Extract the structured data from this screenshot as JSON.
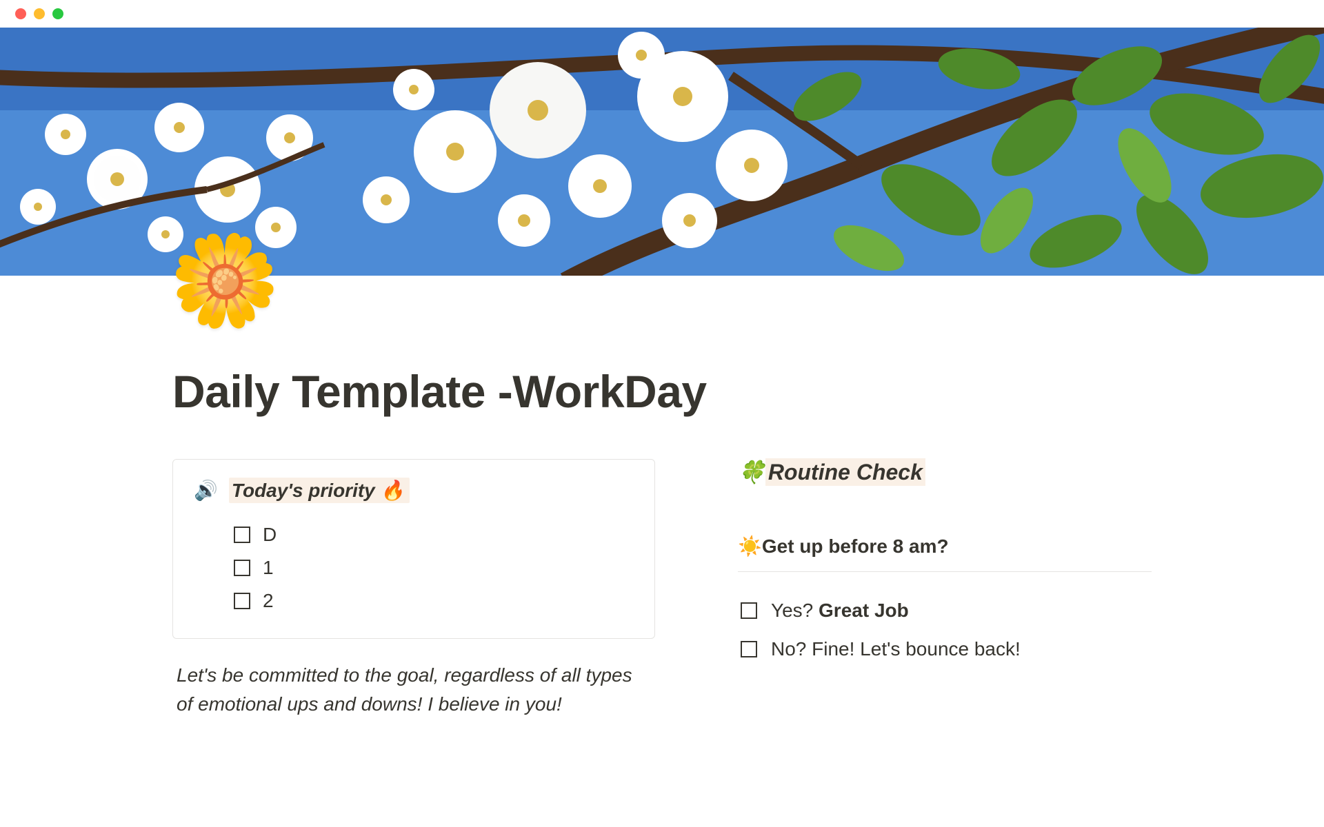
{
  "page": {
    "icon": "🌼",
    "title": "Daily Template -WorkDay"
  },
  "callout": {
    "speaker_icon": "🔊",
    "title_text": "Today's priority",
    "title_emoji": "🔥",
    "items": [
      "D",
      "1",
      "2"
    ]
  },
  "motivation": "Let's be committed to the goal, regardless of all types of emotional ups and downs! I believe in you!",
  "routine": {
    "clover": "🍀",
    "heading_text": "Routine Check",
    "question_emoji": "☀️",
    "question_text": "Get up before 8 am?",
    "answers": {
      "yes_prefix": "Yes? ",
      "yes_bold": "Great Job",
      "no_text": "No? Fine! Let's bounce back!"
    }
  }
}
